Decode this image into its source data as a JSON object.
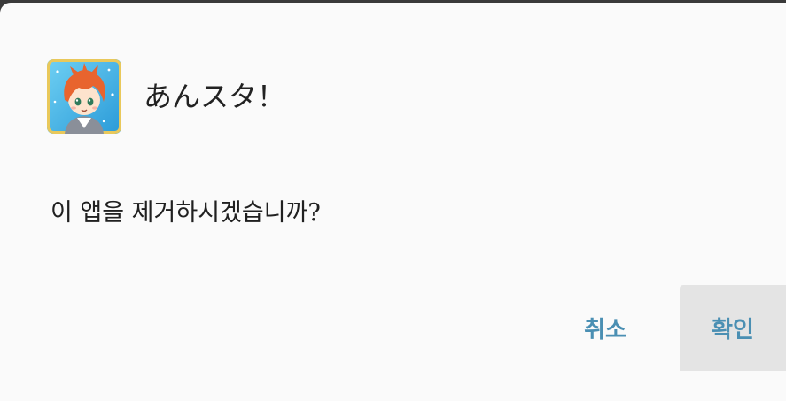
{
  "dialog": {
    "app_icon": "ensemble-stars-app-icon",
    "app_name": "あんスタ！",
    "message": "이 앱을 제거하시겠습니까?",
    "cancel_label": "취소",
    "ok_label": "확인"
  },
  "colors": {
    "dialog_background": "#fafafa",
    "button_text": "#4a8fb3",
    "pressed_button_background": "#e4e4e4"
  }
}
